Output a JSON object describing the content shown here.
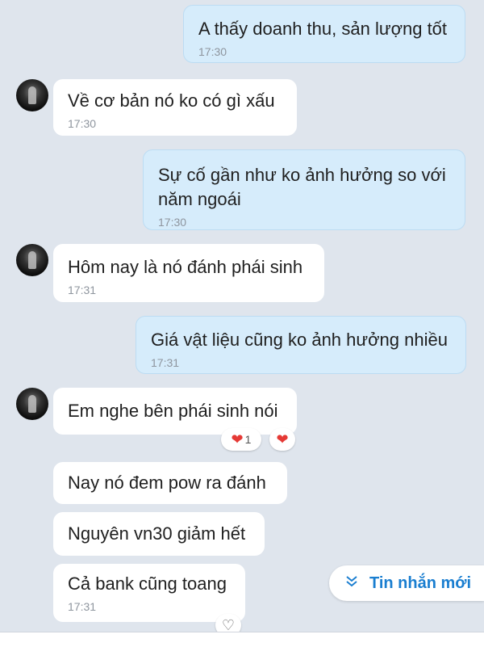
{
  "messages": [
    {
      "text": "A thấy doanh thu, sản lượng tốt",
      "time": "17:30"
    },
    {
      "text": "Về cơ bản nó ko có gì xấu",
      "time": "17:30"
    },
    {
      "text": "Sự cố gần như ko ảnh hưởng so với năm ngoái",
      "time": "17:30"
    },
    {
      "text": "Hôm nay là nó đánh phái sinh",
      "time": "17:31"
    },
    {
      "text": "Giá vật liệu cũng ko ảnh hưởng nhiều",
      "time": "17:31"
    },
    {
      "text": "Em nghe bên phái sinh nói"
    },
    {
      "text": "Nay nó đem pow ra đánh"
    },
    {
      "text": "Nguyên vn30 giảm hết"
    },
    {
      "text": "Cả bank cũng toang",
      "time": "17:31"
    }
  ],
  "reactions": {
    "heart_count": "1"
  },
  "new_messages_button": {
    "label": "Tin nhắn mới",
    "icon": "chevron-double-down-icon"
  },
  "colors": {
    "outgoing": "#d6ecfb",
    "incoming": "#ffffff",
    "background": "#dfe5ed",
    "accent": "#1a7ed0"
  }
}
